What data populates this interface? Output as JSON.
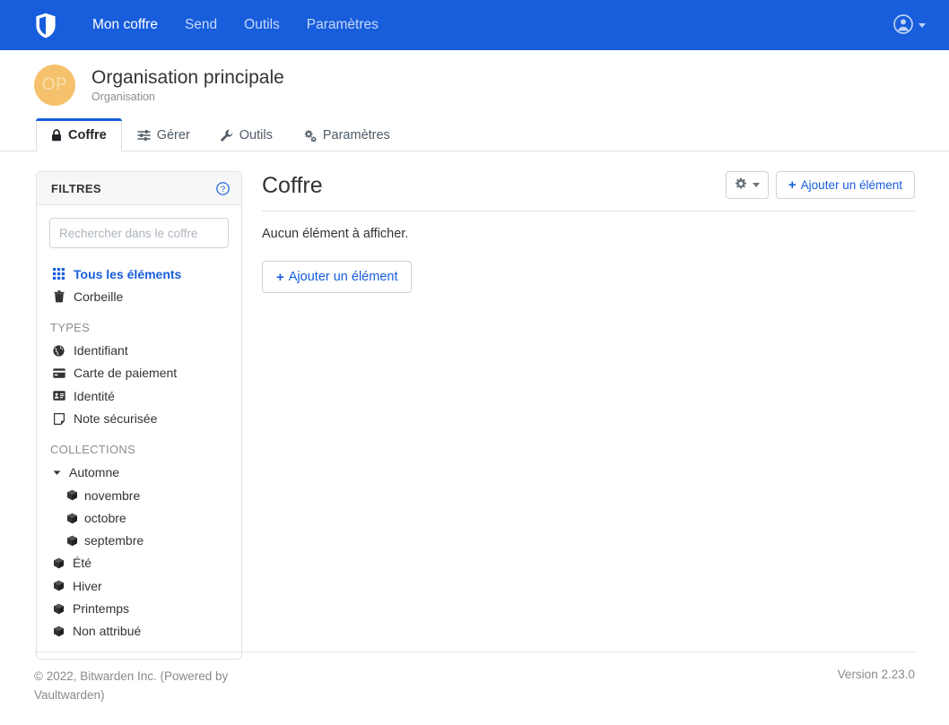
{
  "navbar": {
    "logo_icon": "bitwarden-shield-icon",
    "brand_color": "#175ddc",
    "links": [
      {
        "label": "Mon coffre",
        "active": true
      },
      {
        "label": "Send",
        "active": false
      },
      {
        "label": "Outils",
        "active": false
      },
      {
        "label": "Paramètres",
        "active": false
      }
    ],
    "user_menu": {
      "icon": "user-circle-icon",
      "caret": "chevron-down-icon"
    }
  },
  "organization": {
    "avatar_initials": "OP",
    "avatar_color": "#f5c16c",
    "name": "Organisation principale",
    "subtitle": "Organisation"
  },
  "tabs": [
    {
      "label": "Coffre",
      "icon": "lock-icon",
      "active": true
    },
    {
      "label": "Gérer",
      "icon": "sliders-icon",
      "active": false
    },
    {
      "label": "Outils",
      "icon": "wrench-icon",
      "active": false
    },
    {
      "label": "Paramètres",
      "icon": "gears-icon",
      "active": false
    }
  ],
  "filters": {
    "title": "FILTRES",
    "help_icon": "question-circle-icon",
    "search": {
      "placeholder": "Rechercher dans le coffre",
      "value": ""
    },
    "top_items": [
      {
        "label": "Tous les éléments",
        "icon": "grid-icon",
        "active": true
      },
      {
        "label": "Corbeille",
        "icon": "trash-icon",
        "active": false
      }
    ],
    "types_title": "TYPES",
    "types": [
      {
        "label": "Identifiant",
        "icon": "globe-icon"
      },
      {
        "label": "Carte de paiement",
        "icon": "credit-card-icon"
      },
      {
        "label": "Identité",
        "icon": "id-card-icon"
      },
      {
        "label": "Note sécurisée",
        "icon": "sticky-note-icon"
      }
    ],
    "collections_title": "COLLECTIONS",
    "collections": [
      {
        "label": "Automne",
        "icon": "cube-icon",
        "expandable": true,
        "expanded": true,
        "child": false
      },
      {
        "label": "novembre",
        "icon": "cube-icon",
        "expandable": false,
        "child": true
      },
      {
        "label": "octobre",
        "icon": "cube-icon",
        "expandable": false,
        "child": true
      },
      {
        "label": "septembre",
        "icon": "cube-icon",
        "expandable": false,
        "child": true
      },
      {
        "label": "Été",
        "icon": "cube-icon",
        "expandable": false,
        "child": false
      },
      {
        "label": "Hiver",
        "icon": "cube-icon",
        "expandable": false,
        "child": false
      },
      {
        "label": "Printemps",
        "icon": "cube-icon",
        "expandable": false,
        "child": false
      },
      {
        "label": "Non attribué",
        "icon": "cube-icon",
        "expandable": false,
        "child": false
      }
    ]
  },
  "main": {
    "title": "Coffre",
    "gear_button": {
      "icon": "gear-icon",
      "caret": "chevron-down-icon"
    },
    "add_button_top": {
      "label": "Ajouter un élément",
      "icon": "plus-icon"
    },
    "empty_message": "Aucun élément à afficher.",
    "add_button_below": {
      "label": "Ajouter un élément",
      "icon": "plus-icon"
    },
    "accent_color": "#175ddc"
  },
  "footer": {
    "copyright": "© 2022, Bitwarden Inc. (Powered by Vaultwarden)",
    "version": "Version 2.23.0"
  }
}
